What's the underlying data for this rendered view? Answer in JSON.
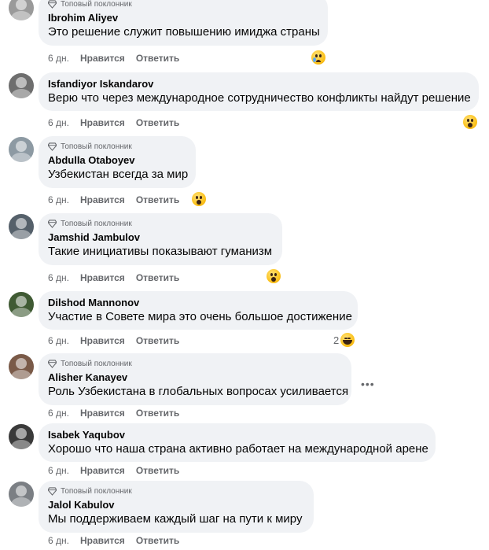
{
  "badge_label": "Топовый поклонник",
  "action_like": "Нравится",
  "action_reply": "Ответить",
  "comments": [
    {
      "name": "Ibrohim Aliyev",
      "text": "Это решение служит повышению имиджа страны",
      "time": "6 дн.",
      "top_fan": true,
      "reaction": "sad",
      "reaction_count": "",
      "avatar_color": "#9a9a9a"
    },
    {
      "name": "Isfandiyor Iskandarov",
      "text": "Верю что через международное сотрудничество конфликты найдут решение",
      "time": "6 дн.",
      "top_fan": false,
      "reaction": "wow",
      "reaction_count": "",
      "avatar_color": "#6e6e6e"
    },
    {
      "name": "Abdulla Otaboyev",
      "text": "Узбекистан всегда за мир",
      "time": "6 дн.",
      "top_fan": true,
      "reaction": "wow",
      "reaction_count": "",
      "avatar_color": "#8d9aa3"
    },
    {
      "name": "Jamshid Jambulov",
      "text": "Такие инициативы показывают гуманизм",
      "time": "6 дн.",
      "top_fan": true,
      "reaction": "wow",
      "reaction_count": "",
      "avatar_color": "#55606a"
    },
    {
      "name": "Dilshod Mannonov",
      "text": "Участие в Совете мира это очень большое достижение",
      "time": "6 дн.",
      "top_fan": false,
      "reaction": "haha",
      "reaction_count": "2",
      "avatar_color": "#3f5a33"
    },
    {
      "name": "Alisher Kanayev",
      "text": "Роль Узбекистана в глобальных вопросах усиливается",
      "time": "6 дн.",
      "top_fan": true,
      "reaction": "",
      "reaction_count": "",
      "avatar_color": "#7a5a48"
    },
    {
      "name": "Isabek Yaqubov",
      "text": "Хорошо что наша страна активно работает на международной арене",
      "time": "6 дн.",
      "top_fan": false,
      "reaction": "",
      "reaction_count": "",
      "avatar_color": "#3a3a3a"
    },
    {
      "name": "Jalol Kabulov",
      "text": "Мы поддерживаем каждый шаг на пути к миру",
      "time": "6 дн.",
      "top_fan": true,
      "reaction": "",
      "reaction_count": "",
      "avatar_color": "#7b7f84"
    }
  ],
  "more_icon_label": "•••"
}
